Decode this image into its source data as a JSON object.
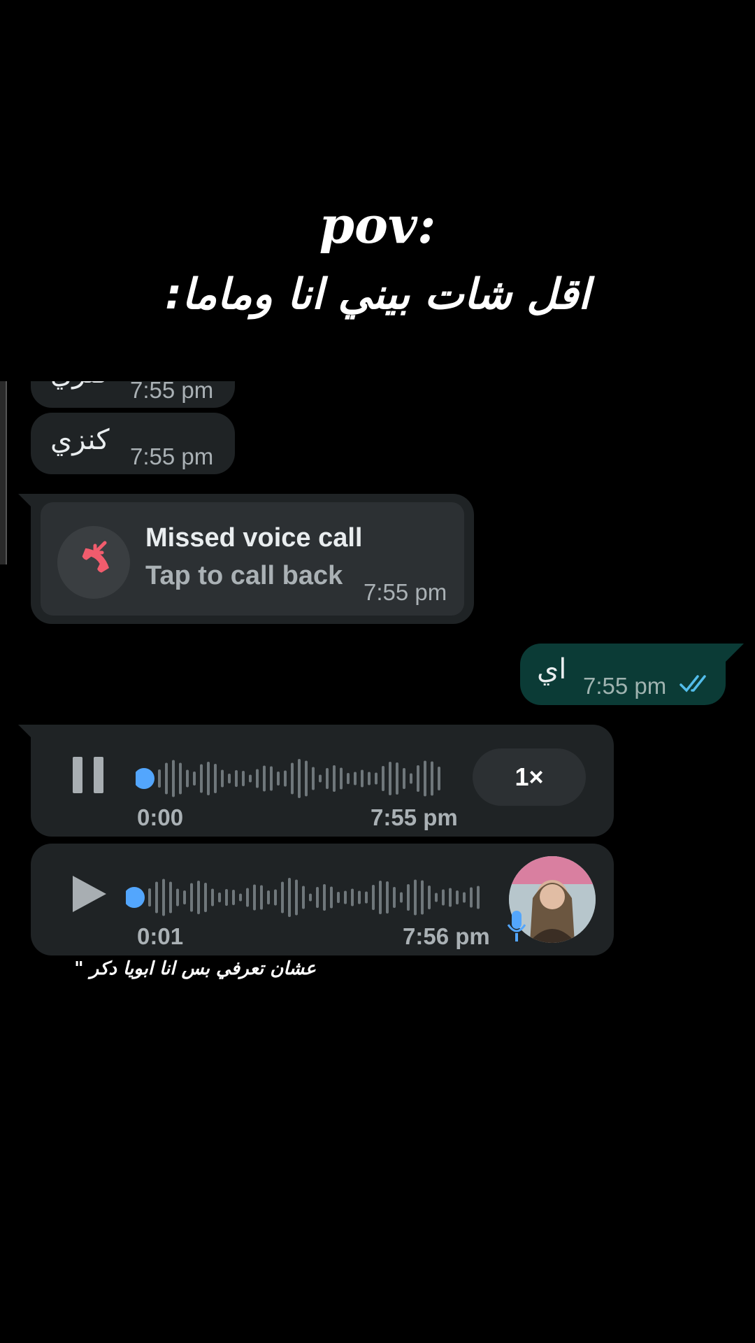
{
  "overlay": {
    "title": "pov:",
    "subtitle": "اقل شات بيني انا وماما:",
    "caption": "عشان تعرفي بس انا ابويا دكر \""
  },
  "chat": {
    "messages": [
      {
        "type": "incoming_text",
        "text": "كنزي",
        "time": "7:55 pm",
        "clipped": true
      },
      {
        "type": "incoming_text",
        "text": "كنزي",
        "time": "7:55 pm"
      },
      {
        "type": "missed_call",
        "title": "Missed voice call",
        "subtitle": "Tap to call back",
        "time": "7:55 pm"
      },
      {
        "type": "outgoing_text",
        "text": "اي",
        "time": "7:55 pm",
        "status": "read"
      },
      {
        "type": "voice",
        "state": "playing",
        "position": "0:00",
        "time": "7:55 pm",
        "speed": "1×"
      },
      {
        "type": "voice",
        "state": "paused",
        "duration": "0:01",
        "time": "7:56 pm"
      }
    ]
  },
  "colors": {
    "incoming_bubble": "#1f2325",
    "outgoing_bubble": "#0b3b36",
    "missed_call_red": "#f15c6d",
    "play_dot_blue": "#53a6fd",
    "read_ticks": "#53bdeb"
  },
  "icons": [
    "missed-call-icon",
    "pause-icon",
    "play-icon",
    "double-check-icon",
    "mic-icon"
  ]
}
